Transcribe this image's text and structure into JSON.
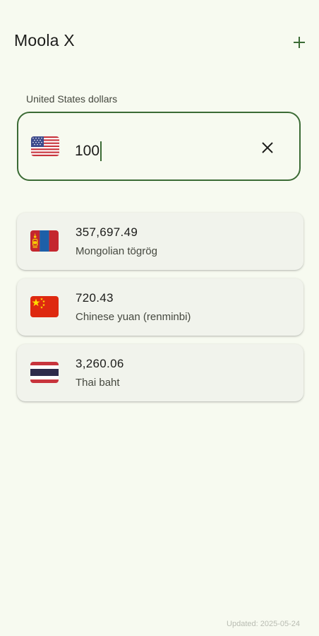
{
  "app": {
    "title": "Moola X",
    "add_icon": "plus-icon",
    "accent_color": "#3b6b35"
  },
  "input": {
    "label": "United States dollars",
    "value": "100",
    "flag": "us-flag-icon",
    "clear_icon": "close-icon"
  },
  "results": [
    {
      "amount": "357,697.49",
      "name": "Mongolian tögrög",
      "flag": "mongolia-flag-icon"
    },
    {
      "amount": "720.43",
      "name": "Chinese yuan (renminbi)",
      "flag": "china-flag-icon"
    },
    {
      "amount": "3,260.06",
      "name": "Thai baht",
      "flag": "thailand-flag-icon"
    }
  ],
  "footer": {
    "updated": "Updated: 2025-05-24"
  }
}
